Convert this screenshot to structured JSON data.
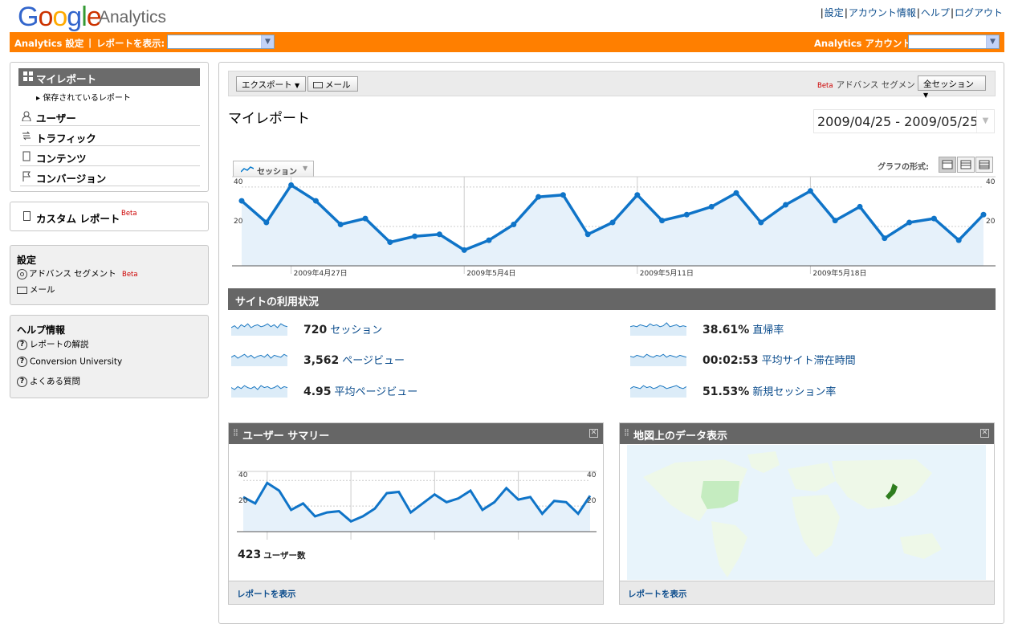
{
  "header": {
    "logo_text": "Google",
    "logo_sub": "Analytics",
    "links": [
      "設定",
      "アカウント情報",
      "ヘルプ",
      "ログアウト"
    ]
  },
  "orangebar": {
    "settings_label": "Analytics 設定",
    "report_label": "レポートを表示:",
    "account_label": "Analytics アカウント:"
  },
  "sidebar": {
    "my_report": "マイレポート",
    "saved_reports": "保存されているレポート",
    "items": [
      "ユーザー",
      "トラフィック",
      "コンテンツ",
      "コンバージョン"
    ],
    "custom_report": "カスタム レポート",
    "beta": "Beta",
    "settings_title": "設定",
    "settings_items": [
      "アドバンス セグメント",
      "メール"
    ],
    "help_title": "ヘルプ情報",
    "help_items": [
      "レポートの解説",
      "Conversion University",
      "よくある質問"
    ]
  },
  "toolbar": {
    "export_label": "エクスポート",
    "email_label": "メール",
    "segment_label": "アドバンス セグメント:",
    "segment_value": "全セッション"
  },
  "page": {
    "title": "マイレポート",
    "date_range": "2009/04/25 - 2009/05/25",
    "graph_metric": "セッション",
    "graph_format_label": "グラフの形式:"
  },
  "usage": {
    "title": "サイトの利用状況",
    "metrics": [
      {
        "value": "720",
        "label": "セッション"
      },
      {
        "value": "3,562",
        "label": "ページビュー"
      },
      {
        "value": "4.95",
        "label": "平均ページビュー"
      },
      {
        "value": "38.61%",
        "label": "直帰率"
      },
      {
        "value": "00:02:53",
        "label": "平均サイト滞在時間"
      },
      {
        "value": "51.53%",
        "label": "新規セッション率"
      }
    ]
  },
  "widgets": {
    "users_title": "ユーザー サマリー",
    "users_count": "423",
    "users_label": "ユーザー数",
    "map_title": "地図上のデータ表示",
    "view_report": "レポートを表示"
  },
  "chart_data": [
    {
      "type": "line",
      "title": "",
      "series": [
        {
          "name": "セッション",
          "values": [
            33,
            22,
            41,
            33,
            21,
            24,
            12,
            15,
            16,
            8,
            13,
            21,
            35,
            36,
            16,
            22,
            36,
            23,
            26,
            30,
            37,
            22,
            31,
            38,
            23,
            30,
            14,
            22,
            24,
            13,
            26
          ]
        }
      ],
      "x_tick_labels": [
        "2009年4月27日",
        "2009年5月4日",
        "2009年5月11日",
        "2009年5月18日"
      ],
      "y_tick_labels": [
        "40",
        "20"
      ],
      "ylim": [
        0,
        42
      ],
      "grid": true
    },
    {
      "type": "line",
      "title": "",
      "series": [
        {
          "name": "",
          "values": [
            27,
            22,
            38,
            32,
            17,
            22,
            12,
            15,
            16,
            8,
            12,
            18,
            30,
            31,
            15,
            22,
            29,
            23,
            26,
            32,
            17,
            23,
            34,
            25,
            27,
            14,
            24,
            23,
            14,
            28
          ]
        }
      ],
      "y_tick_labels": [
        "40",
        "20"
      ],
      "ylim": [
        0,
        42
      ],
      "grid": true
    }
  ]
}
